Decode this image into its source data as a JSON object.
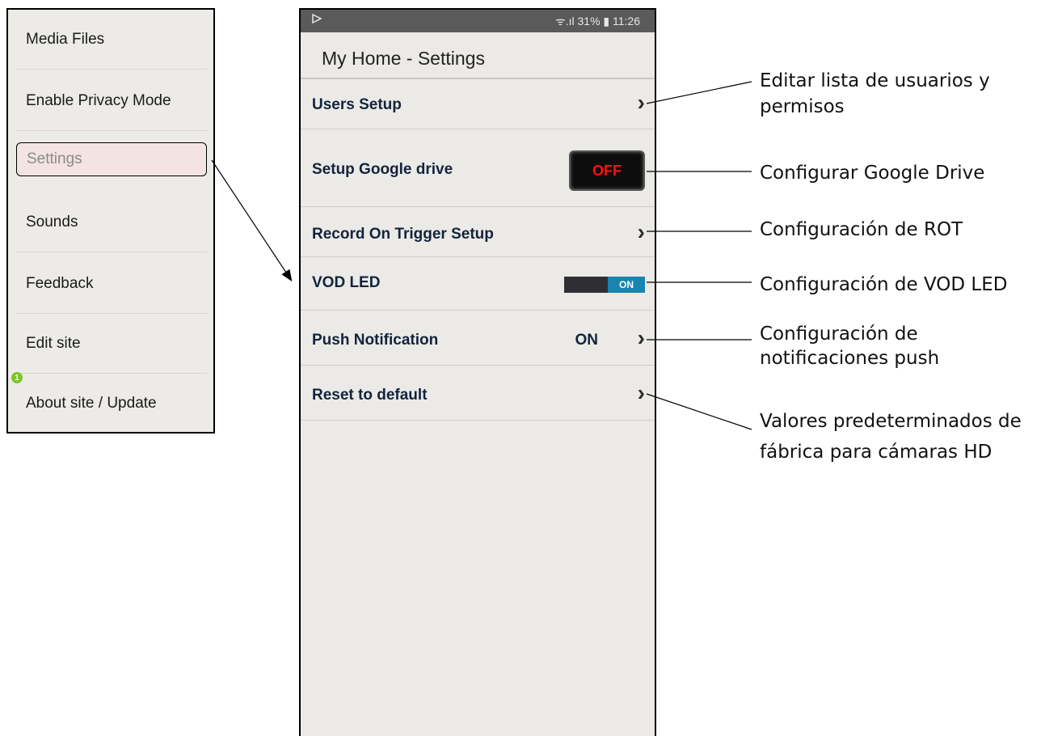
{
  "menu": {
    "items": [
      {
        "label": "Media Files"
      },
      {
        "label": "Enable Privacy Mode"
      },
      {
        "label": "Settings"
      },
      {
        "label": "Sounds"
      },
      {
        "label": "Feedback"
      },
      {
        "label": "Edit site"
      },
      {
        "label": "About site / Update"
      }
    ],
    "badge": "1"
  },
  "status_bar": {
    "left_icon": "play-store-icon",
    "right": "ᯤ.ıl 31% ▮ 11:26"
  },
  "app": {
    "title": "My Home - Settings"
  },
  "rows": [
    {
      "label": "Users Setup"
    },
    {
      "label": "Setup Google drive",
      "button": "OFF"
    },
    {
      "label": "Record On Trigger Setup"
    },
    {
      "label": "VOD LED",
      "toggle": "ON"
    },
    {
      "label": "Push Notification",
      "value": "ON"
    },
    {
      "label": "Reset to default"
    }
  ],
  "chevron": "›",
  "annotations": [
    "Editar lista de usuarios y permisos",
    "Configurar Google Drive",
    "Configuración de ROT",
    "Configuración de VOD LED",
    "Configuración de notificaciones push",
    "Valores predeterminados de fábrica para cámaras HD"
  ],
  "colors": {
    "badge": "#7cc52a",
    "off_text": "#ff1010",
    "toggle_on": "#1a84b0",
    "active_bg": "#f4e4e1"
  }
}
